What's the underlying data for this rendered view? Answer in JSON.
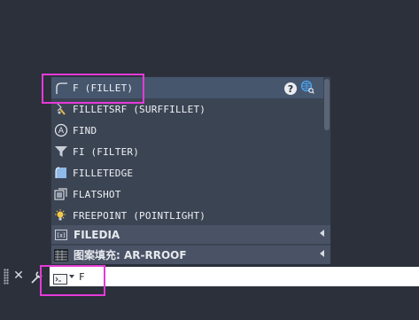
{
  "autocomplete": {
    "items": [
      {
        "label": "F (FILLET)",
        "icon": "fillet-icon"
      },
      {
        "label": "FILLETSRF (SURFFILLET)",
        "icon": "surface-fillet-icon"
      },
      {
        "label": "FIND",
        "icon": "find-icon"
      },
      {
        "label": "FI (FILTER)",
        "icon": "filter-icon"
      },
      {
        "label": "FILLETEDGE",
        "icon": "fillet-edge-icon"
      },
      {
        "label": "FLATSHOT",
        "icon": "flatshot-icon"
      },
      {
        "label": "FREEPOINT (POINTLIGHT)",
        "icon": "point-light-icon"
      }
    ],
    "groups": [
      {
        "label": "FILEDIA",
        "icon": "system-variable-icon"
      },
      {
        "label": "图案填充: AR-RROOF",
        "icon": "hatch-pattern-icon"
      }
    ],
    "top_icons": [
      "help-icon",
      "web-search-icon"
    ],
    "help_glyph": "?"
  },
  "command_line": {
    "input_value": "F",
    "close_glyph": "✕"
  },
  "colors": {
    "highlight": "#e63ad8",
    "popup_bg": "#3b4453",
    "selected_row": "#46566d",
    "group_bg": "#4a5365",
    "canvas_bg": "#2b303b"
  }
}
